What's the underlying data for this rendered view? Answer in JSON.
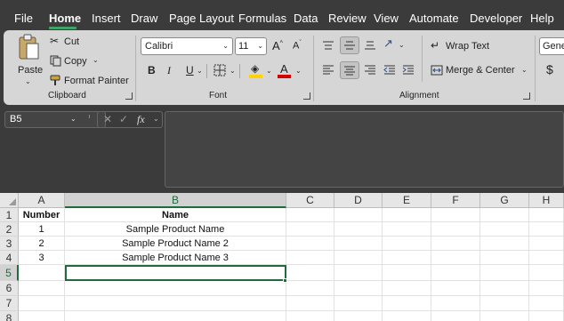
{
  "menu": {
    "tabs": [
      "File",
      "Home",
      "Insert",
      "Draw",
      "Page Layout",
      "Formulas",
      "Data",
      "Review",
      "View",
      "Automate",
      "Developer",
      "Help"
    ],
    "active": "Home"
  },
  "ribbon": {
    "clipboard": {
      "paste": "Paste",
      "cut": "Cut",
      "copy": "Copy",
      "format_painter": "Format Painter",
      "label": "Clipboard"
    },
    "font": {
      "font_name": "Calibri",
      "font_size": "11",
      "bold": "B",
      "italic": "I",
      "underline": "U",
      "label": "Font",
      "fill_color": "#ffd400",
      "font_color": "#d40000"
    },
    "alignment": {
      "wrap_text": "Wrap Text",
      "merge_center": "Merge & Center",
      "label": "Alignment"
    },
    "number": {
      "format": "Gene",
      "currency": "$"
    }
  },
  "formula_bar": {
    "name_box": "B5",
    "fx": "fx",
    "content": ""
  },
  "sheet": {
    "columns": [
      "A",
      "B",
      "C",
      "D",
      "E",
      "F",
      "G",
      "H"
    ],
    "rows": [
      "1",
      "2",
      "3",
      "4",
      "5",
      "6",
      "7",
      "8"
    ],
    "cells": [
      [
        "Number",
        "Name"
      ],
      [
        "1",
        "Sample Product Name"
      ],
      [
        "2",
        "Sample Product Name 2"
      ],
      [
        "3",
        "Sample Product Name 3"
      ]
    ],
    "selected_cell": "B5",
    "accent": "#1f6b3a"
  }
}
